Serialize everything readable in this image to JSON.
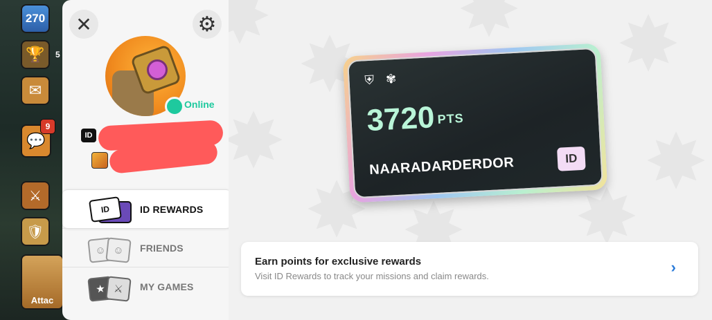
{
  "game_hud": {
    "xp_level": "270",
    "trophy_fragment": "5",
    "chat_badge": "9",
    "attack_label": "Attac"
  },
  "profile_panel": {
    "status": "Online",
    "id_badge": "ID"
  },
  "menu": {
    "items": [
      {
        "label": "ID REWARDS",
        "icon": "id-card-icon",
        "active": true
      },
      {
        "label": "FRIENDS",
        "icon": "friends-icon",
        "active": false
      },
      {
        "label": "MY GAMES",
        "icon": "games-icon",
        "active": false
      }
    ],
    "id_card_icon_text": "ID"
  },
  "points_card": {
    "points": "3720",
    "unit": "PTS",
    "player_name": "NAARADARDERDOR",
    "badge": "ID",
    "emblems": "⛨ ✾"
  },
  "info_row": {
    "title": "Earn points for exclusive rewards",
    "subtitle": "Visit ID Rewards to track your missions and claim rewards.",
    "chevron": "›"
  },
  "colors": {
    "online": "#1ec99e",
    "points": "#b9f5d8",
    "link": "#2a7bd9",
    "redaction": "#ff5a5a"
  }
}
